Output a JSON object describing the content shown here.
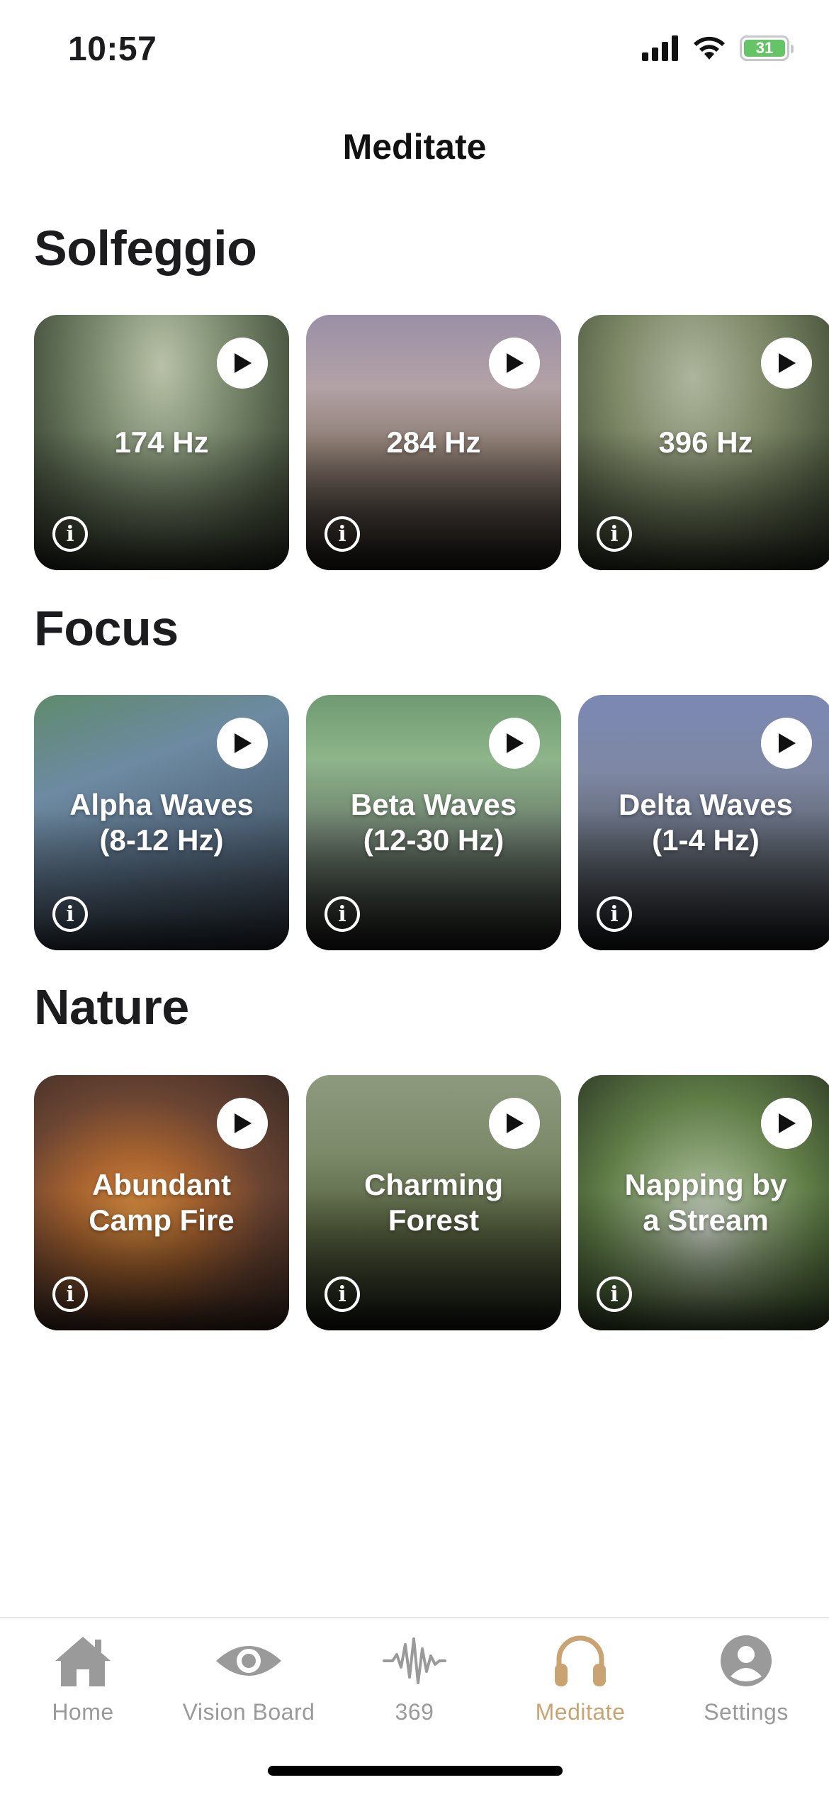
{
  "status_bar": {
    "time": "10:57",
    "battery": "31"
  },
  "header": {
    "title": "Meditate"
  },
  "sections": [
    {
      "title": "Solfeggio",
      "cards": [
        {
          "title": "174 Hz",
          "bg": "forest"
        },
        {
          "title": "284 Hz",
          "bg": "lake"
        },
        {
          "title": "396 Hz",
          "bg": "forest"
        }
      ]
    },
    {
      "title": "Focus",
      "cards": [
        {
          "title": "Alpha Waves\n(8-12 Hz)",
          "bg": "aurora1"
        },
        {
          "title": "Beta Waves\n(12-30 Hz)",
          "bg": "aurora2"
        },
        {
          "title": "Delta Waves\n(1-4 Hz)",
          "bg": "aurora3"
        }
      ]
    },
    {
      "title": "Nature",
      "cards": [
        {
          "title": "Abundant\nCamp Fire",
          "bg": "fire"
        },
        {
          "title": "Charming\nForest",
          "bg": "forest2"
        },
        {
          "title": "Napping by\na Stream",
          "bg": "stream"
        }
      ]
    }
  ],
  "tab_bar": {
    "items": [
      {
        "label": "Home",
        "icon": "home-icon"
      },
      {
        "label": "Vision Board",
        "icon": "eye-icon"
      },
      {
        "label": "369",
        "icon": "waveform-icon"
      },
      {
        "label": "Meditate",
        "icon": "headphones-icon",
        "active": true
      },
      {
        "label": "Settings",
        "icon": "person-icon"
      }
    ]
  },
  "colors": {
    "accent": "#c9a472",
    "inactive": "#9a9a9a"
  }
}
